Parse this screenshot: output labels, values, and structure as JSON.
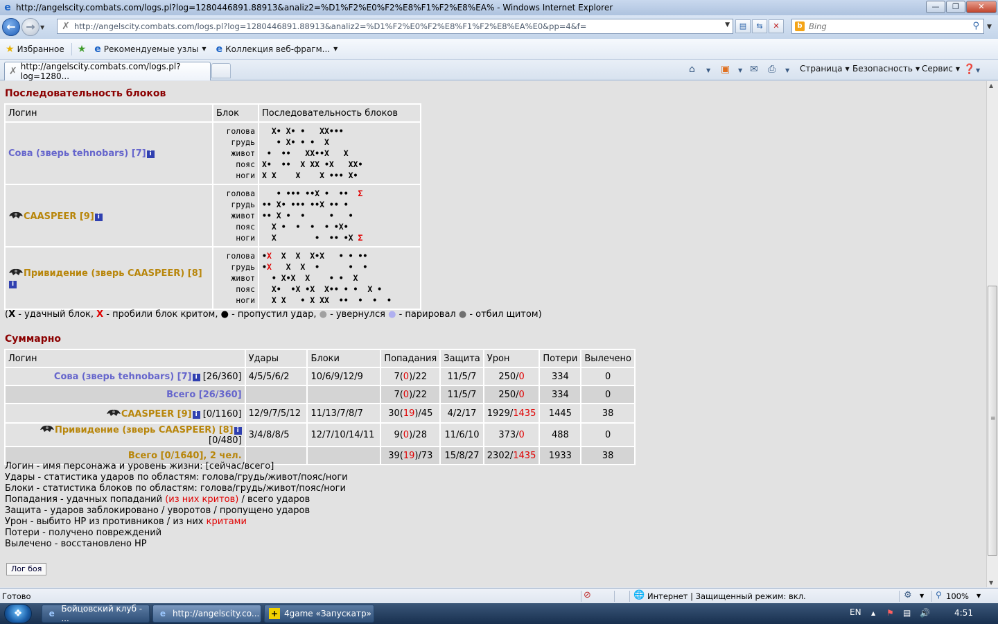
{
  "window": {
    "title": "http://angelscity.combats.com/logs.pl?log=1280446891.88913&analiz2=%D1%F2%E0%F2%E8%F1%F2%E8%EA% - Windows Internet Explorer"
  },
  "address": {
    "url": "http://angelscity.combats.com/logs.pl?log=1280446891.88913&analiz2=%D1%F2%E0%F2%E8%F1%F2%E8%EA%E0&pp=4&f="
  },
  "search": {
    "placeholder": "Bing"
  },
  "favorites": {
    "fav_label": "Избранное",
    "recommended": "Рекомендуемые узлы",
    "collection": "Коллекция веб-фрагм..."
  },
  "tab": {
    "title": "http://angelscity.combats.com/logs.pl?log=1280..."
  },
  "commands": {
    "page": "Страница",
    "safety": "Безопасность",
    "tools": "Сервис"
  },
  "blocks": {
    "title": "Последовательность блоков",
    "headers": [
      "Логин",
      "Блок",
      "Последовательность блоков"
    ],
    "zones": "голова\nгрудь\nживот\nпояс\nноги",
    "rows": [
      {
        "name": "Сова (зверь tehnobars) [7]",
        "seq_html": "  X• X• •   XX•••\n   • X• • •  X\n •  ••   XX••X   X\nX•  ••  X XX •X   XX•\nX X    X    X ••• X•"
      },
      {
        "name": "CAASPEER [9]",
        "seq_html": "   • ••• ••X •  ••  Σ\n•• X• ••• ••X •• •\n•• X •  •     •   •\n  X •  •  •  • •X•\n  X        •  •• •X Σ"
      },
      {
        "name": "Привидение (зверь CAASPEER) [8]",
        "seq_html": "•X  X  X  X•X   • • ••\n•X   X  X  •      •  •\n  • X•X  X    • •  X\n  X•  •X •X  X•• • •  X •\n  X X   • X XX  ••  •  •  •"
      }
    ]
  },
  "legend": {
    "x_label": "X",
    "x_text": " - удачный блок, ",
    "xr_label": "X",
    "xr_text": " - пробили блок критом, ",
    "miss_text": " - пропустил удар, ",
    "dodge_text": " - увернулся ",
    "parry_text": " - парировал ",
    "shield_text": " - отбил щитом)",
    "open": "(",
    "dot": "●"
  },
  "summary": {
    "title": "Суммарно",
    "headers": [
      "Логин",
      "Удары",
      "Блоки",
      "Попадания",
      "Защита",
      "Урон",
      "Потери",
      "Вылечено"
    ],
    "rows": [
      {
        "kind": "player",
        "team": "blue",
        "name": "Сова (зверь tehnobars) [7]",
        "hp": "[26/360]",
        "hits": "4/5/5/6/2",
        "blocks": "10/6/9/12/9",
        "land_a": "7(",
        "land_crit": "0",
        "land_b": ")/22",
        "def": "11/5/7",
        "dmg": "250/",
        "dmg_crit": "0",
        "loss": "334",
        "heal": "0"
      },
      {
        "kind": "total",
        "team": "blue",
        "name": "Всего [26/360]",
        "land_a": "7(",
        "land_crit": "0",
        "land_b": ")/22",
        "def": "11/5/7",
        "dmg": "250/",
        "dmg_crit": "0",
        "loss": "334",
        "heal": "0"
      },
      {
        "kind": "player",
        "team": "brown",
        "name": "CAASPEER [9]",
        "hp": "[0/1160]",
        "hits": "12/9/7/5/12",
        "blocks": "11/13/7/8/7",
        "land_a": "30(",
        "land_crit": "19",
        "land_b": ")/45",
        "def": "4/2/17",
        "dmg": "1929/",
        "dmg_crit": "1435",
        "loss": "1445",
        "heal": "38"
      },
      {
        "kind": "player",
        "team": "brown",
        "name": "Привидение (зверь CAASPEER) [8]",
        "hp": "[0/480]",
        "hits": "3/4/8/8/5",
        "blocks": "12/7/10/14/11",
        "land_a": "9(",
        "land_crit": "0",
        "land_b": ")/28",
        "def": "11/6/10",
        "dmg": "373/",
        "dmg_crit": "0",
        "loss": "488",
        "heal": "0"
      },
      {
        "kind": "total",
        "team": "brown",
        "name": "Всего [0/1640], 2 чел.",
        "land_a": "39(",
        "land_crit": "19",
        "land_b": ")/73",
        "def": "15/8/27",
        "dmg": "2302/",
        "dmg_crit": "1435",
        "loss": "1933",
        "heal": "38"
      }
    ]
  },
  "notes": {
    "n1": "Логин - имя персонажа и уровень жизни: [сейчас/всего]",
    "n2": "Удары - статистика ударов по областям: голова/грудь/живот/пояс/ноги",
    "n3": "Блоки - статистика блоков по областям: голова/грудь/живот/пояс/ноги",
    "n4a": "Попадания - удачных попаданий ",
    "n4b": "(из них критов)",
    "n4c": " / всего ударов",
    "n5": "Защита - ударов заблокировано / уворотов / пропущено ударов",
    "n6a": "Урон - выбито HP из противников / из них ",
    "n6b": "критами",
    "n7": "Потери - получено повреждений",
    "n8": "Вылечено - восстановлено HP"
  },
  "log_button": "Лог боя",
  "status": {
    "ready": "Готово",
    "zone": "Интернет | Защищенный режим: вкл.",
    "zoom": "100%"
  },
  "taskbar": {
    "items": [
      "Бойцовский клуб - ...",
      "http://angelscity.co...",
      "4game «Запускатр»"
    ],
    "lang": "EN",
    "time": "4:51"
  }
}
